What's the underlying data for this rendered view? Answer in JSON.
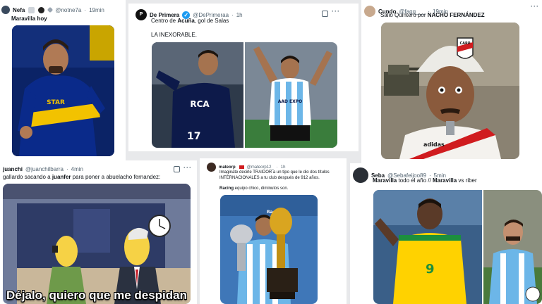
{
  "tweets": [
    {
      "name": "Nefa",
      "handle": "@notne7a",
      "time": "19min",
      "text": "Maravilla hoy",
      "media_icons": [
        "player-photo-icon"
      ]
    },
    {
      "name": "De Primera",
      "handle": "@DePrimeraa",
      "time": "1h",
      "text_parts": [
        "Centro de ",
        "Acuña",
        ", gol de Salas"
      ],
      "text2": "LA INEXORABLE.",
      "photo_right_jersey": "AAD EXPO"
    },
    {
      "name": "Cundo",
      "handle": "@fagg___",
      "time": "19min",
      "text_parts": [
        "Salió Quintero por ",
        "NACHO FERNÁNDEZ"
      ],
      "helmet_logo": "CARP"
    },
    {
      "name": "juanchi",
      "handle": "@juanchilbarra",
      "time": "4min",
      "text_parts": [
        "gallardo sacando a ",
        "juanfer",
        " para poner a abuelacho fernandez:"
      ],
      "caption": "Déjalo, quiero que me despidan"
    },
    {
      "name": "mateorp",
      "handle": "@mateorp12_",
      "time": "1h",
      "text_line1": "Imaginate decirle TRAIDOR a un tipo que le dio dos títulos",
      "text_line2": "INTERNACIONALES a tu club después de 912 años.",
      "text_line3_parts": [
        "Racing",
        " equipo chico, diminutos son."
      ],
      "banner_text": "Racing"
    },
    {
      "name": "Seba",
      "handle": "@Sebafeijoo89",
      "time": "5min",
      "text_parts": [
        "Maravilla",
        " todo el año // ",
        "Maravilla",
        " vs riber"
      ],
      "jersey_number": "9"
    }
  ],
  "dot": "·",
  "more": "···",
  "colors": {
    "link_blue": "#1d9bf0",
    "text_gray": "#536471",
    "boca_blue": "#0a2a8a",
    "boca_yellow": "#f2c200",
    "racing_blue": "#6cb6e8",
    "river_red": "#d01c1f",
    "brazil_yellow": "#ffd200",
    "brazil_green": "#1c8f3d"
  }
}
